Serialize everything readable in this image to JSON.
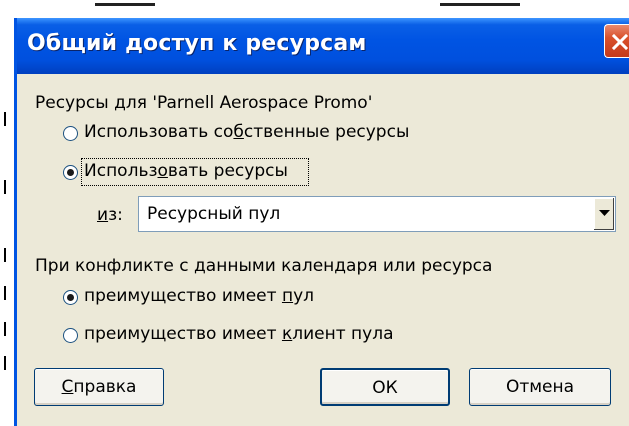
{
  "dialog": {
    "title": "Общий доступ к ресурсам"
  },
  "resources_group": {
    "label": "Ресурсы для 'Parnell Aerospace Promo'",
    "option_own": {
      "pre": "Использовать со",
      "key": "б",
      "post": "ственные ресурсы",
      "checked": false
    },
    "option_pool": {
      "pre": "Использ",
      "key": "о",
      "post": "вать ресурсы",
      "checked": true
    },
    "from_label": {
      "key": "и",
      "post": "з:"
    },
    "from_value": "Ресурсный пул"
  },
  "conflict_group": {
    "label": "При конфликте с данными календаря или ресурса",
    "option_pool_wins": {
      "pre": "преимущество имеет ",
      "key": "п",
      "post": "ул",
      "checked": true
    },
    "option_client_wins": {
      "pre": "преимущество имеет ",
      "key": "к",
      "post": "лиент пула",
      "checked": false
    }
  },
  "buttons": {
    "help": {
      "key": "С",
      "post": "правка"
    },
    "ok": "ОК",
    "cancel": "Отмена"
  },
  "colors": {
    "titlebar": "#0054e3",
    "dialog_bg": "#ece9d8",
    "close_button": "#d9512b",
    "radio_selected": "#21a121"
  },
  "icons": {
    "close": "close-icon",
    "dropdown": "chevron-down-icon"
  }
}
